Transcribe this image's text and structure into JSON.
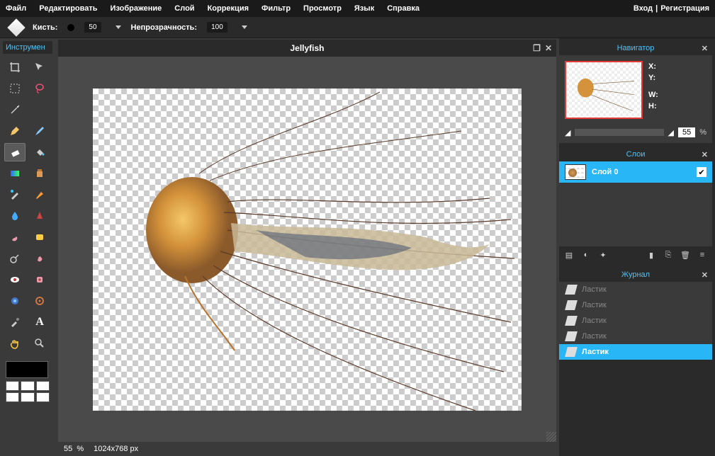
{
  "menu": [
    "Файл",
    "Редактировать",
    "Изображение",
    "Слой",
    "Коррекция",
    "Фильтр",
    "Просмотр",
    "Язык",
    "Справка"
  ],
  "auth": {
    "login": "Вход",
    "sep": "|",
    "register": "Регистрация"
  },
  "options": {
    "brush_label": "Кисть:",
    "brush_value": "50",
    "opacity_label": "Непрозрачность:",
    "opacity_value": "100"
  },
  "toolbox": {
    "title": "Инструмен"
  },
  "document": {
    "title": "Jellyfish"
  },
  "status": {
    "zoom": "55",
    "zoom_unit": "%",
    "dims": "1024x768 px"
  },
  "navigator": {
    "title": "Навигатор",
    "labels": {
      "x": "X:",
      "y": "Y:",
      "w": "W:",
      "h": "H:"
    },
    "zoom": "55",
    "zoom_unit": "%"
  },
  "layers": {
    "title": "Слои",
    "items": [
      {
        "name": "Слой 0",
        "visible": true
      }
    ]
  },
  "history": {
    "title": "Журнал",
    "items": [
      "Ластик",
      "Ластик",
      "Ластик",
      "Ластик",
      "Ластик"
    ],
    "active_index": 4
  }
}
